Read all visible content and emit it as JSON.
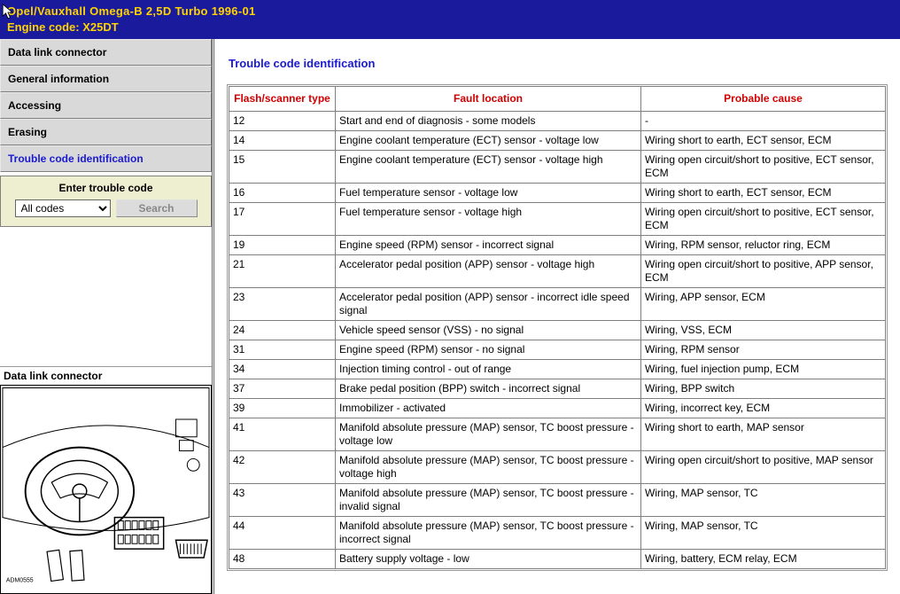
{
  "header": {
    "line1": "Opel/Vauxhall   Omega-B 2,5D Turbo 1996-01",
    "line2": "Engine code: X25DT"
  },
  "sidebar": {
    "items": [
      {
        "label": "Data link connector"
      },
      {
        "label": "General information"
      },
      {
        "label": "Accessing"
      },
      {
        "label": "Erasing"
      },
      {
        "label": "Trouble code identification"
      }
    ],
    "selected_index": 4
  },
  "search": {
    "label": "Enter trouble code",
    "selected": "All codes",
    "button": "Search"
  },
  "diagram": {
    "title": "Data link connector"
  },
  "content": {
    "title": "Trouble code identification",
    "columns": [
      "Flash/scanner type",
      "Fault location",
      "Probable cause"
    ],
    "rows": [
      {
        "code": "12",
        "fault": "Start and end of diagnosis - some models",
        "cause": "-"
      },
      {
        "code": "14",
        "fault": "Engine coolant temperature (ECT) sensor - voltage low",
        "cause": "Wiring short to earth, ECT sensor, ECM"
      },
      {
        "code": "15",
        "fault": "Engine coolant temperature (ECT) sensor - voltage high",
        "cause": "Wiring open circuit/short to positive, ECT sensor, ECM"
      },
      {
        "code": "16",
        "fault": "Fuel temperature sensor - voltage low",
        "cause": "Wiring short to earth, ECT sensor, ECM"
      },
      {
        "code": "17",
        "fault": "Fuel temperature sensor - voltage high",
        "cause": "Wiring open circuit/short to positive, ECT sensor, ECM"
      },
      {
        "code": "19",
        "fault": "Engine speed (RPM) sensor - incorrect signal",
        "cause": "Wiring, RPM sensor, reluctor ring, ECM"
      },
      {
        "code": "21",
        "fault": "Accelerator pedal position (APP) sensor - voltage high",
        "cause": "Wiring open circuit/short to positive, APP sensor, ECM"
      },
      {
        "code": "23",
        "fault": "Accelerator pedal position (APP) sensor - incorrect idle speed signal",
        "cause": "Wiring, APP sensor, ECM"
      },
      {
        "code": "24",
        "fault": "Vehicle speed sensor (VSS) - no signal",
        "cause": "Wiring, VSS, ECM"
      },
      {
        "code": "31",
        "fault": "Engine speed (RPM) sensor - no signal",
        "cause": "Wiring, RPM sensor"
      },
      {
        "code": "34",
        "fault": "Injection timing control - out of range",
        "cause": "Wiring, fuel injection pump, ECM"
      },
      {
        "code": "37",
        "fault": "Brake pedal position (BPP) switch - incorrect signal",
        "cause": "Wiring, BPP switch"
      },
      {
        "code": "39",
        "fault": "Immobilizer - activated",
        "cause": "Wiring, incorrect key, ECM"
      },
      {
        "code": "41",
        "fault": "Manifold absolute pressure (MAP) sensor, TC boost pressure - voltage low",
        "cause": "Wiring short to earth, MAP sensor"
      },
      {
        "code": "42",
        "fault": "Manifold absolute pressure (MAP) sensor, TC boost pressure - voltage high",
        "cause": "Wiring open circuit/short to positive, MAP sensor"
      },
      {
        "code": "43",
        "fault": "Manifold absolute pressure (MAP) sensor, TC boost pressure - invalid signal",
        "cause": "Wiring, MAP sensor, TC"
      },
      {
        "code": "44",
        "fault": "Manifold absolute pressure (MAP) sensor, TC boost pressure - incorrect signal",
        "cause": "Wiring, MAP sensor, TC"
      },
      {
        "code": "48",
        "fault": "Battery supply voltage - low",
        "cause": "Wiring, battery, ECM relay, ECM"
      }
    ]
  }
}
